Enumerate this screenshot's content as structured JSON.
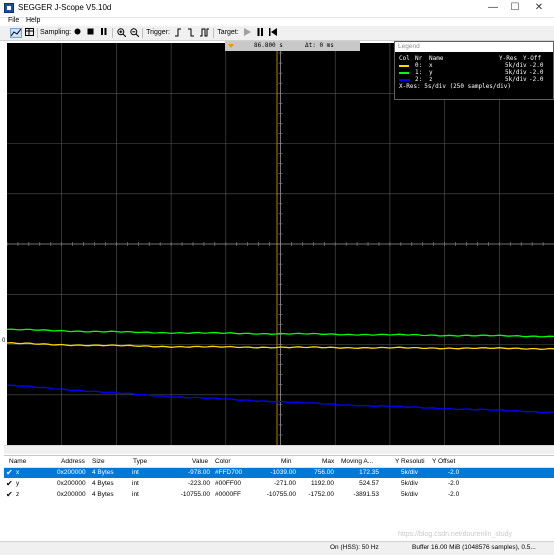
{
  "window": {
    "title": "SEGGER J-Scope V5.10d",
    "minimize": "—",
    "maximize": "☐",
    "close": "✕"
  },
  "menu": [
    {
      "label": "File"
    },
    {
      "label": "Help"
    }
  ],
  "toolbar": {
    "sampling_label": "Sampling:",
    "trigger_label": "Trigger:",
    "target_label": "Target:"
  },
  "scope": {
    "time_readout": "86.800 s",
    "delta_readout": "Δt: 0 ms",
    "zero_marker": "0",
    "colors": {
      "background": "#000000",
      "grid": "#555555"
    }
  },
  "legend": {
    "title": "Legend",
    "header": {
      "col": "Col",
      "nr": "Nr",
      "name": "Name",
      "yres": "Y-Res",
      "yoff": "Y-Off"
    },
    "rows": [
      {
        "nr": "0:",
        "name": "x",
        "yres": "5k/div",
        "yoff": "-2.0",
        "color": "#FFD700"
      },
      {
        "nr": "1:",
        "name": "y",
        "yres": "5k/div",
        "yoff": "-2.0",
        "color": "#00FF00"
      },
      {
        "nr": "2:",
        "name": "z",
        "yres": "5k/div",
        "yoff": "-2.0",
        "color": "#0000FF"
      }
    ],
    "xres": "X-Res: 5s/div (250 samples/div)"
  },
  "chart_data": {
    "type": "line",
    "xlabel": "",
    "ylabel": "",
    "series": [
      {
        "name": "x",
        "color": "#FFD700",
        "y": [
          -200,
          -350,
          -420,
          -500,
          -560,
          -600,
          -620,
          -640,
          -660,
          -680,
          -700,
          -720,
          -740,
          -770
        ]
      },
      {
        "name": "y",
        "color": "#00FF00",
        "y": [
          1150,
          1050,
          950,
          870,
          820,
          780,
          740,
          700,
          660,
          620,
          580,
          540,
          500,
          460
        ]
      },
      {
        "name": "z",
        "color": "#0000FF",
        "y": [
          -4400,
          -4700,
          -5000,
          -5300,
          -5550,
          -5750,
          -5950,
          -6150,
          -6350,
          -6500,
          -6650,
          -6800,
          -6950,
          -7100
        ]
      }
    ]
  },
  "table": {
    "columns": [
      "Name",
      "Address",
      "Size",
      "Type",
      "Value",
      "Color",
      "Min",
      "Max",
      "Moving A...",
      "Y Resoluti",
      "Y Offset"
    ],
    "rows": [
      {
        "name": "x",
        "address": "0x200000",
        "size": "4 Bytes",
        "type": "int",
        "value": "-978.00",
        "color": "#FFD700",
        "min": "-1039.00",
        "max": "756.00",
        "moving": "172.35",
        "yres": "5k/div",
        "yoff": "-2.0"
      },
      {
        "name": "y",
        "address": "0x200000",
        "size": "4 Bytes",
        "type": "int",
        "value": "-223.00",
        "color": "#00FF00",
        "min": "-271.00",
        "max": "1192.00",
        "moving": "524.57",
        "yres": "5k/div",
        "yoff": "-2.0"
      },
      {
        "name": "z",
        "address": "0x200000",
        "size": "4 Bytes",
        "type": "int",
        "value": "-10755.00",
        "color": "#0000FF",
        "min": "-10755.00",
        "max": "-1752.00",
        "moving": "-3891.53",
        "yres": "5k/div",
        "yoff": "-2.0"
      }
    ]
  },
  "status": {
    "rate": "On (HSS): 50 Hz",
    "buffer": "Buffer 16.00 MiB (1048576 samples), 0.5..."
  },
  "watermark": "https://blog.csdn.net/dourenlin_study"
}
